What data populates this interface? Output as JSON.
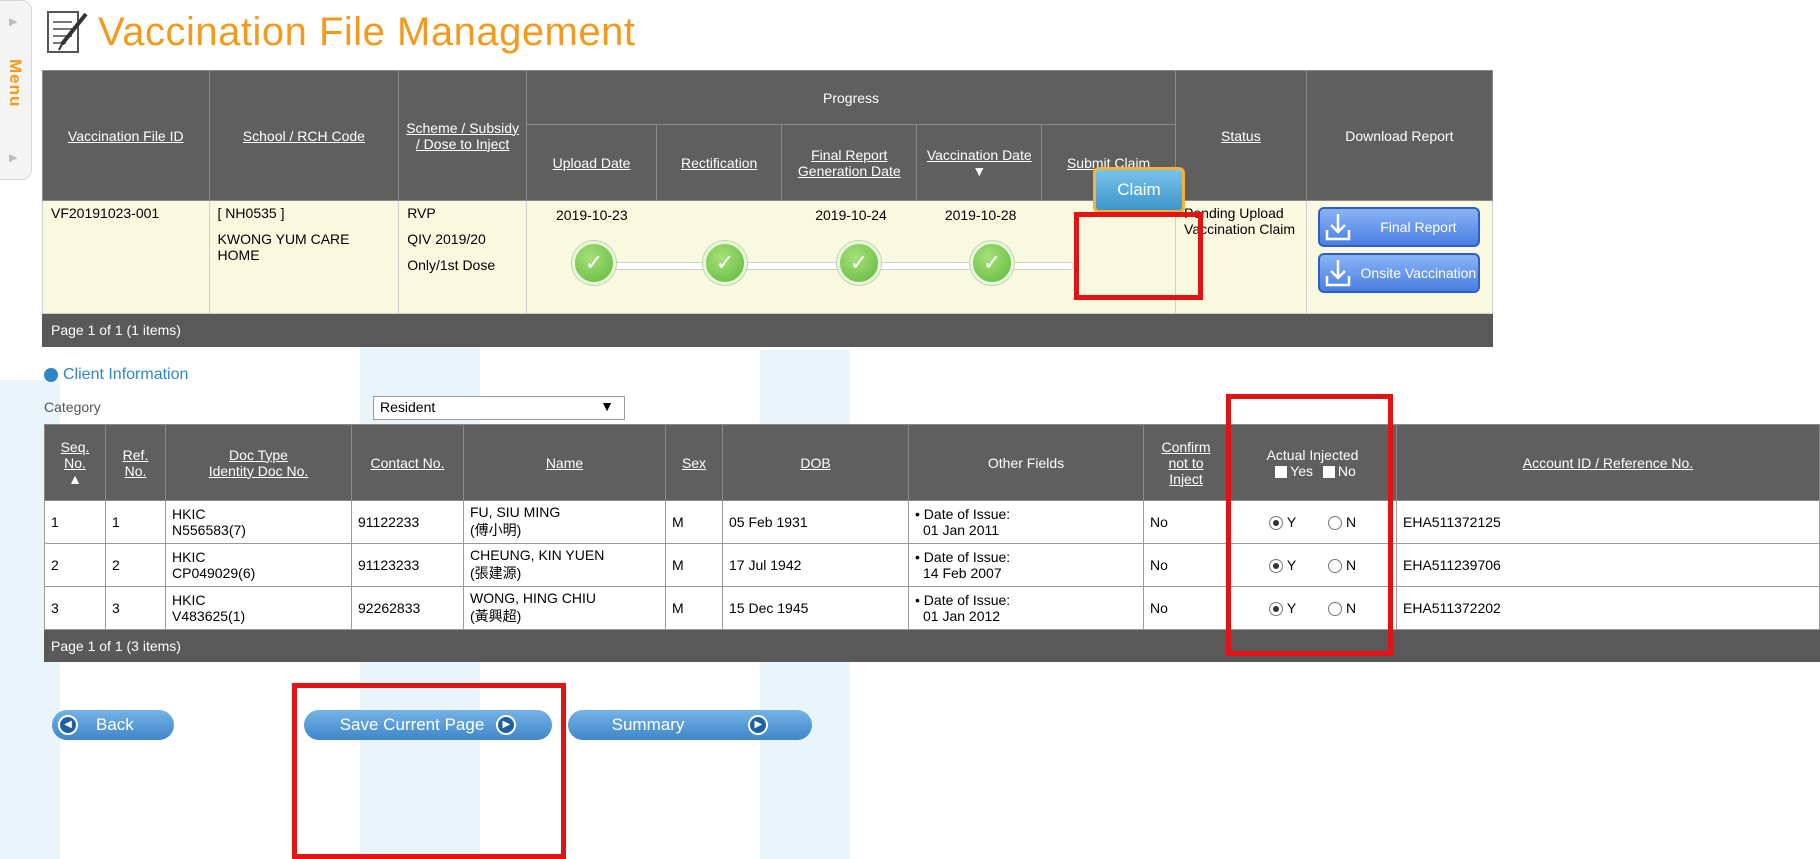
{
  "menu": {
    "label": "Menu"
  },
  "page": {
    "title": "Vaccination File Management"
  },
  "vaccination_files": {
    "headers": {
      "file_id": "Vaccination File ID",
      "school_code": "School / RCH Code",
      "scheme": "Scheme / Subsidy / Dose to Inject",
      "progress": "Progress",
      "upload_date": "Upload Date",
      "rectification": "Rectification",
      "final_report": "Final Report Generation Date",
      "vaccination_date": "Vaccination Date",
      "submit_claim": "Submit Claim",
      "status": "Status",
      "download_report": "Download Report"
    },
    "row": {
      "file_id": "VF20191023-001",
      "school_code": "[ NH0535 ]",
      "school_name": "KWONG YUM CARE HOME",
      "scheme": "RVP",
      "subsidy": "QIV 2019/20",
      "dose": "Only/1st Dose",
      "upload_date": "2019-10-23",
      "final_report_date": "2019-10-24",
      "vaccination_date": "2019-10-28",
      "claim_button": "Claim",
      "status": "Pending Upload Vaccination Claim",
      "final_report_button": "Final Report",
      "onsite_button": "Onsite Vaccination"
    },
    "footer": "Page 1 of 1 (1 items)",
    "check_symbol": "✓"
  },
  "client_info": {
    "section_title": "Client Information",
    "category_label": "Category",
    "category_value": "Resident",
    "headers": {
      "seq_no": "Seq. No.",
      "ref_no": "Ref. No.",
      "doc_type": "Doc Type",
      "identity_doc": "Identity Doc No.",
      "contact": "Contact No.",
      "name": "Name",
      "sex": "Sex",
      "dob": "DOB",
      "other": "Other Fields",
      "confirm": "Confirm not to Inject",
      "actual_injected": "Actual Injected",
      "yes": "Yes",
      "no": "No",
      "account": "Account ID / Reference No."
    },
    "rows": [
      {
        "seq": "1",
        "ref": "1",
        "doc_type": "HKIC",
        "doc_no": "N556583(7)",
        "contact": "91122233",
        "name_en": "FU, SIU MING",
        "name_zh": "(傅小明)",
        "sex": "M",
        "dob": "05 Feb 1931",
        "other_label": "• Date of Issue:",
        "other_value": "01 Jan 2011",
        "confirm": "No",
        "y": "Y",
        "n": "N",
        "account": "EHA511372125"
      },
      {
        "seq": "2",
        "ref": "2",
        "doc_type": "HKIC",
        "doc_no": "CP049029(6)",
        "contact": "91123233",
        "name_en": "CHEUNG, KIN YUEN",
        "name_zh": "(張建源)",
        "sex": "M",
        "dob": "17 Jul 1942",
        "other_label": "• Date of Issue:",
        "other_value": "14 Feb 2007",
        "confirm": "No",
        "y": "Y",
        "n": "N",
        "account": "EHA511239706"
      },
      {
        "seq": "3",
        "ref": "3",
        "doc_type": "HKIC",
        "doc_no": "V483625(1)",
        "contact": "92262833",
        "name_en": "WONG, HING CHIU",
        "name_zh": "(黃興超)",
        "sex": "M",
        "dob": "15 Dec 1945",
        "other_label": "• Date of Issue:",
        "other_value": "01 Jan 2012",
        "confirm": "No",
        "y": "Y",
        "n": "N",
        "account": "EHA511372202"
      }
    ],
    "footer": "Page 1 of 1 (3 items)"
  },
  "buttons": {
    "back": "Back",
    "save": "Save Current Page",
    "summary": "Summary"
  },
  "colors": {
    "title_orange": "#f39a1e",
    "header_grey": "#5f5f5f",
    "row_cream": "#f9f9e0",
    "highlight_red": "#e31313",
    "accent_blue": "#2e86c8"
  }
}
